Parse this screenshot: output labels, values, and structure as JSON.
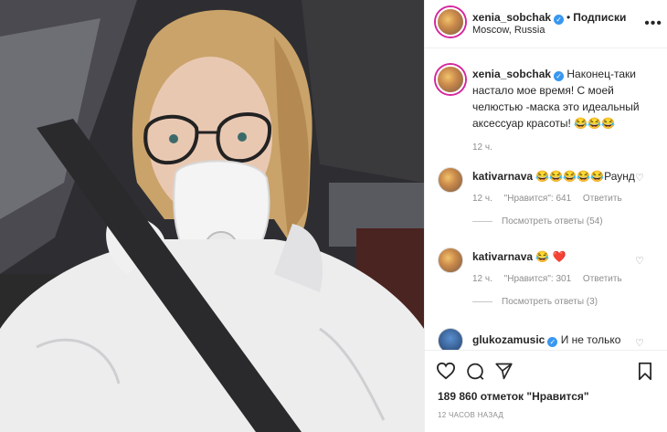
{
  "header": {
    "username": "xenia_sobchak",
    "dot": "•",
    "follow_label": "Подписки",
    "location": "Moscow, Russia"
  },
  "caption": {
    "username": "xenia_sobchak",
    "text": "Наконец-таки настало мое время! С моей челюстью -маска это идеальный аксессуар красоты! 😂😂😂",
    "time": "12 ч."
  },
  "comments": [
    {
      "username": "kativarnava",
      "text": "😂😂😂😂😂Раунд",
      "time": "12 ч.",
      "likes": "\"Нравится\": 641",
      "reply": "Ответить",
      "view_replies": "Посмотреть ответы (54)"
    },
    {
      "username": "kativarnava",
      "text": "😂 ❤️",
      "time": "12 ч.",
      "likes": "\"Нравится\": 301",
      "reply": "Ответить",
      "view_replies": "Посмотреть ответы (3)"
    },
    {
      "username": "glukozamusic",
      "text": "И не только",
      "time": "",
      "likes": "",
      "reply": "",
      "view_replies": ""
    }
  ],
  "actions": {
    "likes": "189 860 отметок \"Нравится\"",
    "timestamp": "12 ЧАСОВ НАЗАД"
  },
  "icons": {
    "like": "heart-icon",
    "comment": "comment-icon",
    "share": "share-icon",
    "save": "bookmark-icon",
    "more": "more-icon"
  },
  "colors": {
    "verified": "#3897f0",
    "muted": "#8e8e8e",
    "text": "#262626",
    "heart_red": "#e0245e"
  }
}
